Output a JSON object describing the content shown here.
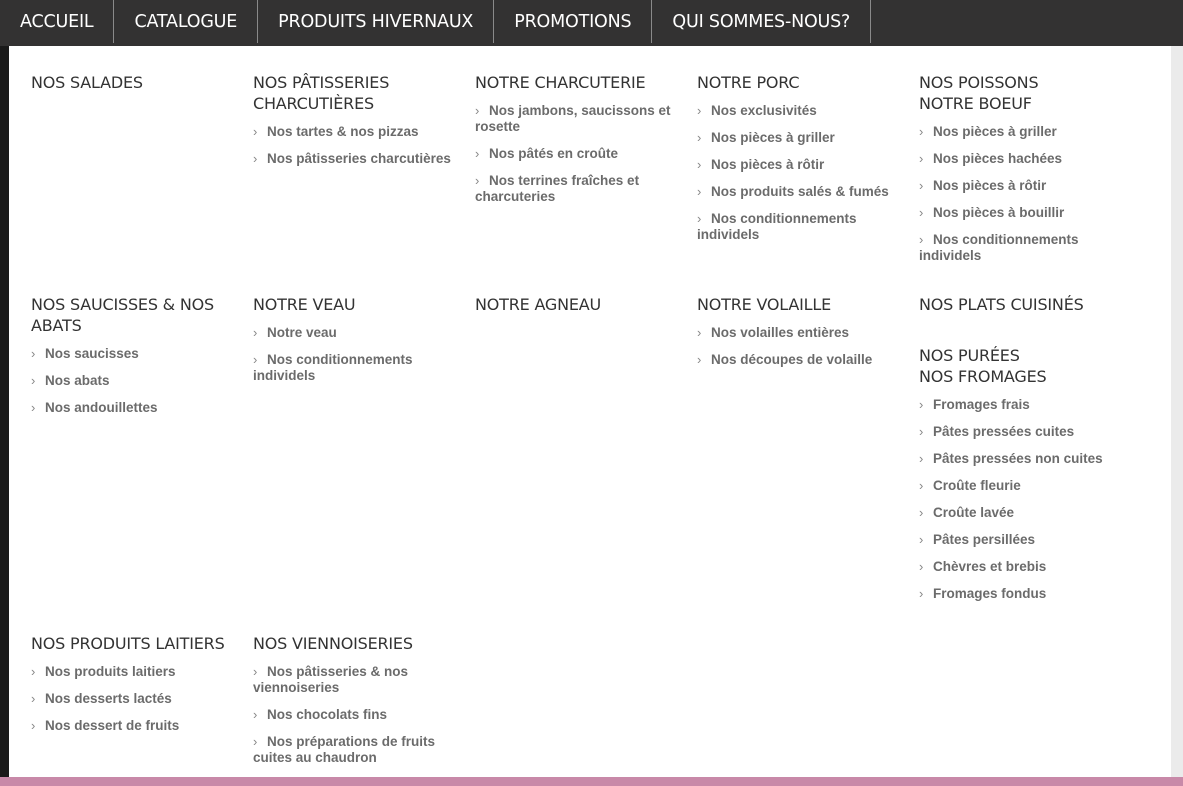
{
  "nav": [
    "ACCUEIL",
    "CATALOGUE",
    "PRODUITS HIVERNAUX",
    "PROMOTIONS",
    "QUI SOMMES-NOUS?"
  ],
  "chevron_icon": "chevron-right-icon",
  "menu": {
    "salades": {
      "title": "NOS SALADES"
    },
    "patisseries_charcutieres": {
      "title_line1": "NOS PÂTISSERIES",
      "title_line2": "CHARCUTIÈRES",
      "items": [
        "Nos tartes & nos pizzas",
        "Nos pâtisseries charcutières"
      ]
    },
    "charcuterie": {
      "title": "NOTRE CHARCUTERIE",
      "items": [
        "Nos jambons, saucissons et rosette",
        "Nos pâtés en croûte",
        "Nos terrines fraîches et charcuteries"
      ]
    },
    "porc": {
      "title": "NOTRE PORC",
      "items": [
        "Nos exclusivités",
        "Nos pièces à griller",
        "Nos pièces à rôtir",
        "Nos produits salés & fumés",
        "Nos conditionnements individels"
      ]
    },
    "poissons_boeuf": {
      "title_line1": "NOS POISSONS",
      "title_line2": "NOTRE BOEUF",
      "items": [
        "Nos pièces à griller",
        "Nos pièces hachées",
        "Nos pièces à rôtir",
        "Nos pièces à bouillir",
        "Nos conditionnements individels"
      ]
    },
    "saucisses_abats": {
      "title_line1": "NOS SAUCISSES & NOS",
      "title_line2": "ABATS",
      "items": [
        "Nos saucisses",
        "Nos abats",
        "Nos andouillettes"
      ]
    },
    "veau": {
      "title": "NOTRE VEAU",
      "items": [
        "Notre veau",
        "Nos conditionnements individels"
      ]
    },
    "agneau": {
      "title": "NOTRE AGNEAU"
    },
    "volaille": {
      "title": "NOTRE VOLAILLE",
      "items": [
        "Nos volailles entières",
        "Nos découpes de volaille"
      ]
    },
    "plats_cuisines": {
      "title": "NOS PLATS CUISINÉS"
    },
    "purees_fromages": {
      "title_line1": "NOS PURÉES",
      "title_line2": "NOS FROMAGES",
      "items": [
        "Fromages frais",
        "Pâtes pressées cuites",
        "Pâtes pressées non cuites",
        "Croûte fleurie",
        "Croûte lavée",
        "Pâtes persillées",
        "Chèvres et brebis",
        "Fromages fondus"
      ]
    },
    "produits_laitiers": {
      "title": "NOS PRODUITS LAITIERS",
      "items": [
        "Nos produits laitiers",
        "Nos desserts lactés",
        "Nos dessert de fruits"
      ]
    },
    "viennoiseries": {
      "title": "NOS VIENNOISERIES",
      "items": [
        "Nos pâtisseries & nos viennoiseries",
        "Nos chocolats fins",
        "Nos préparations de fruits cuites au chaudron"
      ]
    }
  }
}
